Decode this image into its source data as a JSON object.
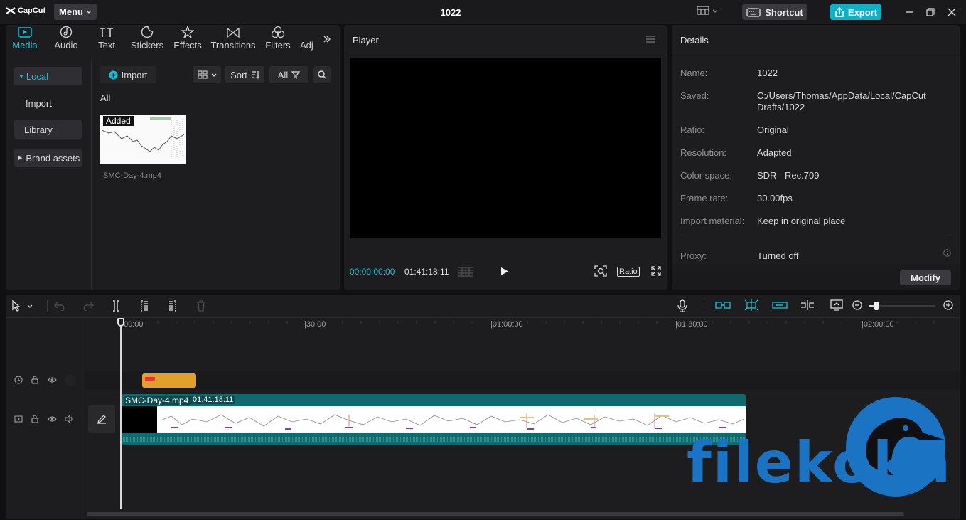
{
  "app": {
    "name": "CapCut",
    "menu_label": "Menu",
    "project_title": "1022",
    "shortcut_label": "Shortcut",
    "export_label": "Export",
    "accent": "#19c0d4"
  },
  "media_tabs": [
    {
      "label": "Media",
      "icon": "media-icon",
      "active": true
    },
    {
      "label": "Audio",
      "icon": "audio-icon"
    },
    {
      "label": "Text",
      "icon": "text-icon"
    },
    {
      "label": "Stickers",
      "icon": "stickers-icon"
    },
    {
      "label": "Effects",
      "icon": "effects-icon"
    },
    {
      "label": "Transitions",
      "icon": "transitions-icon"
    },
    {
      "label": "Filters",
      "icon": "filters-icon"
    },
    {
      "label": "Adj",
      "icon": "adjust-icon"
    }
  ],
  "media_sidebar": {
    "local": "Local",
    "import": "Import",
    "library": "Library",
    "brand_assets": "Brand assets"
  },
  "media_toolbar": {
    "import": "Import",
    "sort": "Sort",
    "filter": "All"
  },
  "media_content": {
    "filter_label": "All",
    "item_name": "SMC-Day-4.mp4",
    "item_badge": "Added"
  },
  "player": {
    "title": "Player",
    "current_time": "00:00:00:00",
    "duration": "01:41:18:11",
    "ratio_label": "Ratio"
  },
  "details": {
    "title": "Details",
    "rows": [
      {
        "label": "Name:",
        "value": "1022"
      },
      {
        "label": "Saved:",
        "value": "C:/Users/Thomas/AppData/Local/CapCut Drafts/1022"
      },
      {
        "label": "Ratio:",
        "value": "Original"
      },
      {
        "label": "Resolution:",
        "value": "Adapted"
      },
      {
        "label": "Color space:",
        "value": "SDR - Rec.709"
      },
      {
        "label": "Frame rate:",
        "value": "30.00fps"
      },
      {
        "label": "Import material:",
        "value": "Keep in original place"
      },
      {
        "label": "Proxy:",
        "value": "Turned off"
      }
    ],
    "modify_label": "Modify"
  },
  "timeline": {
    "ruler": [
      "00:00",
      "|30:00",
      "|01:00:00",
      "|01:30:00",
      "|02:00:00"
    ],
    "clip_name": "SMC-Day-4.mp4",
    "clip_duration": "01:41:18:11"
  },
  "watermark": {
    "text": "filekoka"
  }
}
